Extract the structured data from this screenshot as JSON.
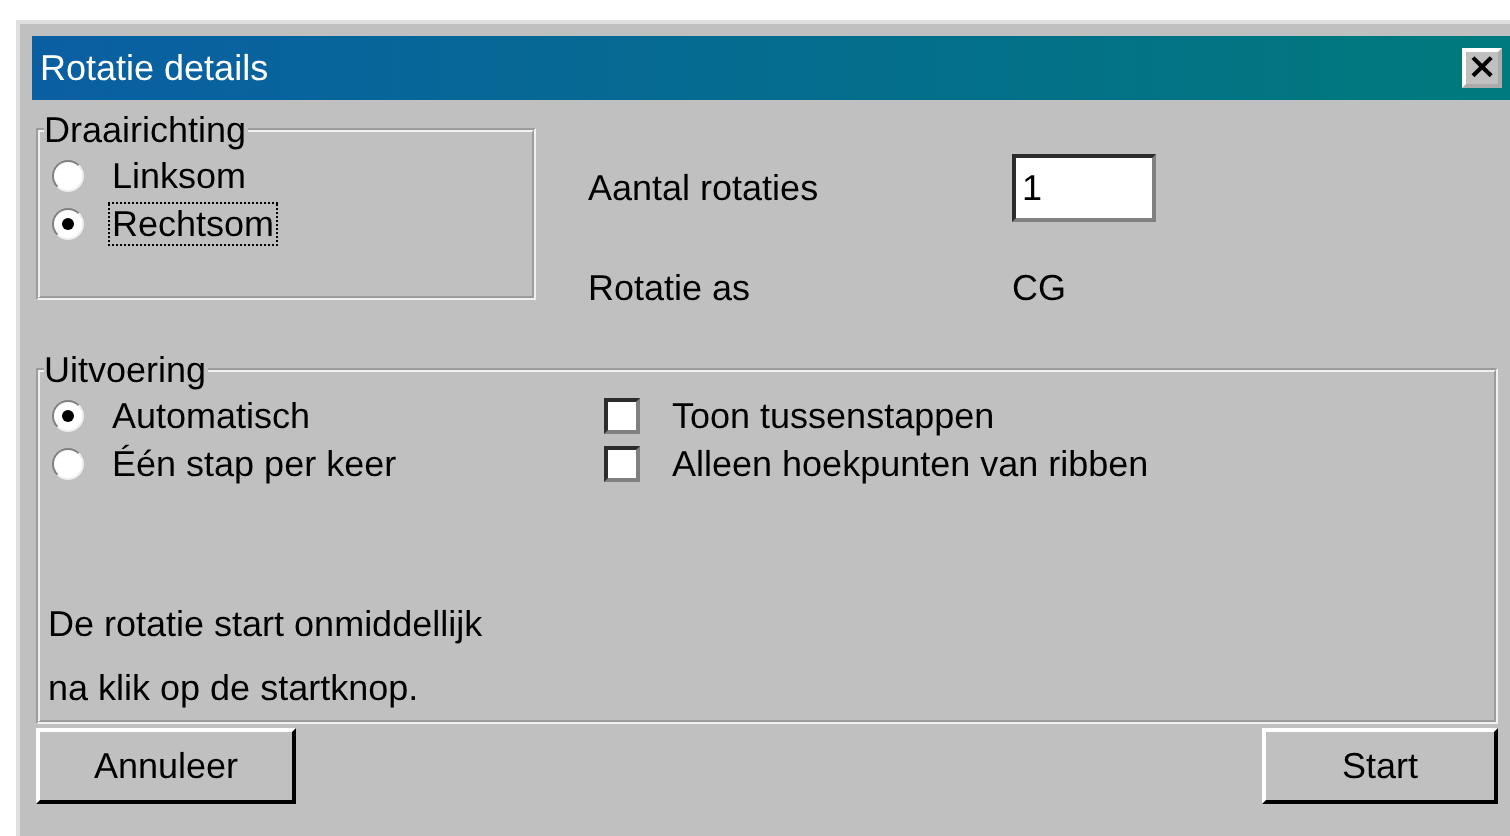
{
  "window": {
    "title": "Rotatie details",
    "close": "×"
  },
  "direction": {
    "legend": "Draairichting",
    "options": [
      {
        "label": "Linksom",
        "selected": false,
        "focused": false
      },
      {
        "label": "Rechtsom",
        "selected": true,
        "focused": true
      }
    ]
  },
  "count": {
    "label": "Aantal rotaties",
    "value": "1"
  },
  "axis": {
    "label": "Rotatie as",
    "value": "CG"
  },
  "execution": {
    "legend": "Uitvoering",
    "modes": [
      {
        "label": "Automatisch",
        "selected": true
      },
      {
        "label": "Één stap per keer",
        "selected": false
      }
    ],
    "options": [
      {
        "label": "Toon tussenstappen",
        "checked": false
      },
      {
        "label": "Alleen hoekpunten van ribben",
        "checked": false
      }
    ],
    "note": [
      "De rotatie start onmiddellijk",
      "na klik op de startknop."
    ]
  },
  "buttons": [
    {
      "label": "Annuleer",
      "kind": "cancel"
    },
    {
      "label": "Start",
      "kind": "start"
    }
  ]
}
